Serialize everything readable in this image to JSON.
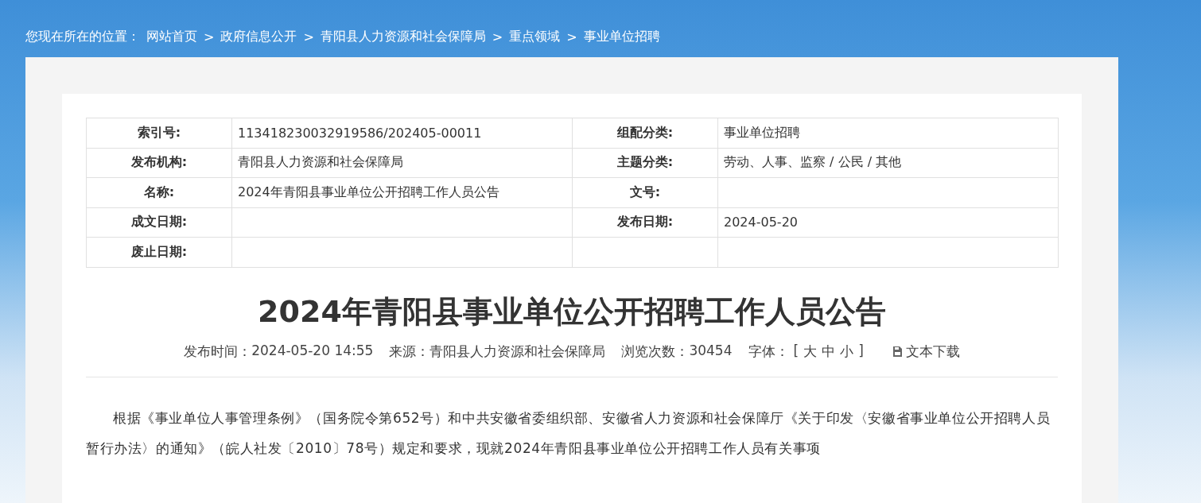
{
  "breadcrumb": {
    "label": "您现在所在的位置：",
    "separator": ">",
    "items": [
      "网站首页",
      "政府信息公开",
      "青阳县人力资源和社会保障局",
      "重点领域",
      "事业单位招聘"
    ]
  },
  "info_table": {
    "rows": [
      [
        {
          "label": "索引号:",
          "value": "113418230032919586/202405-00011"
        },
        {
          "label": "组配分类:",
          "value": "事业单位招聘"
        }
      ],
      [
        {
          "label": "发布机构:",
          "value": "青阳县人力资源和社会保障局"
        },
        {
          "label": "主题分类:",
          "value": "劳动、人事、监察 / 公民 / 其他"
        }
      ],
      [
        {
          "label": "名称:",
          "value": "2024年青阳县事业单位公开招聘工作人员公告"
        },
        {
          "label": "文号:"
        }
      ],
      [
        {
          "label": "成文日期:"
        },
        {
          "label": "发布日期:",
          "value": "2024-05-20"
        }
      ],
      [
        {
          "label": "废止日期:"
        },
        {}
      ]
    ]
  },
  "article": {
    "title": "2024年青阳县事业单位公开招聘工作人员公告",
    "meta": [
      {
        "label": "发布时间：",
        "value": "2024-05-20 14:55"
      },
      {
        "label": "来源：",
        "value": "青阳县人力资源和社会保障局"
      },
      {
        "label": "浏览次数：",
        "value": "30454"
      }
    ],
    "font_size": {
      "label": "字体：",
      "open": "[",
      "sizes": [
        "大",
        "中",
        "小"
      ],
      "close": "]"
    },
    "download": {
      "label": "文本下载"
    },
    "paragraphs": [
      "根据《事业单位人事管理条例》（国务院令第652号）和中共安徽省委组织部、安徽省人力资源和社会保障厅《关于印发〈安徽省事业单位公开招聘人员暂行办法〉的通知》（皖人社发〔2010〕78号）规定和要求，现就2024年青阳县事业单位公开招聘工作人员有关事项"
    ]
  }
}
